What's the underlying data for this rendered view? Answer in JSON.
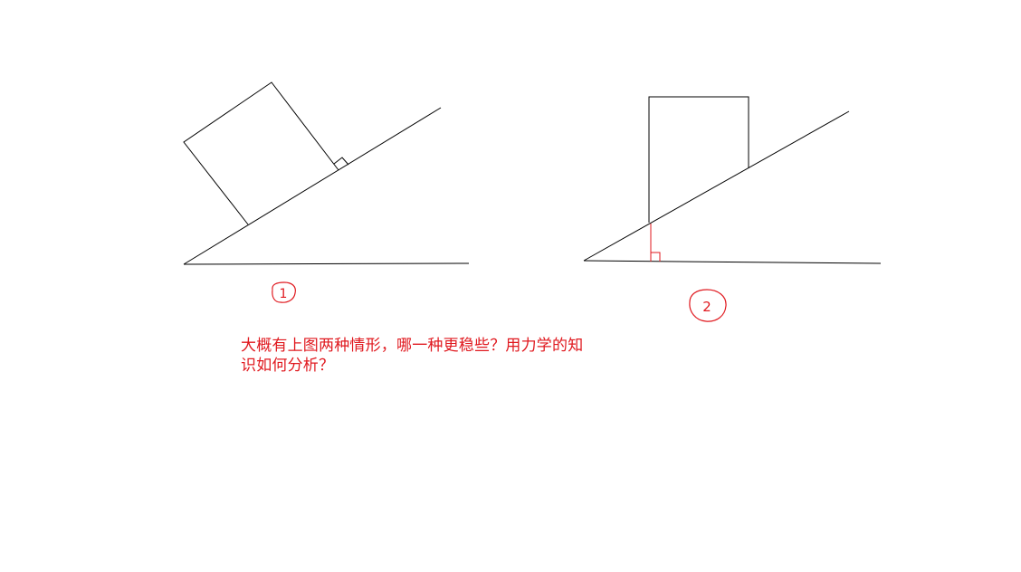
{
  "colors": {
    "background": "#ffffff",
    "diagram_line": "#000000",
    "annotation": "#e0191f"
  },
  "figure_labels": {
    "figure_1": "1",
    "figure_2": "2"
  },
  "question": {
    "line_1": "大概有上图两种情形，哪一种更稳些？用力学的知",
    "line_2": "识如何分析？"
  }
}
